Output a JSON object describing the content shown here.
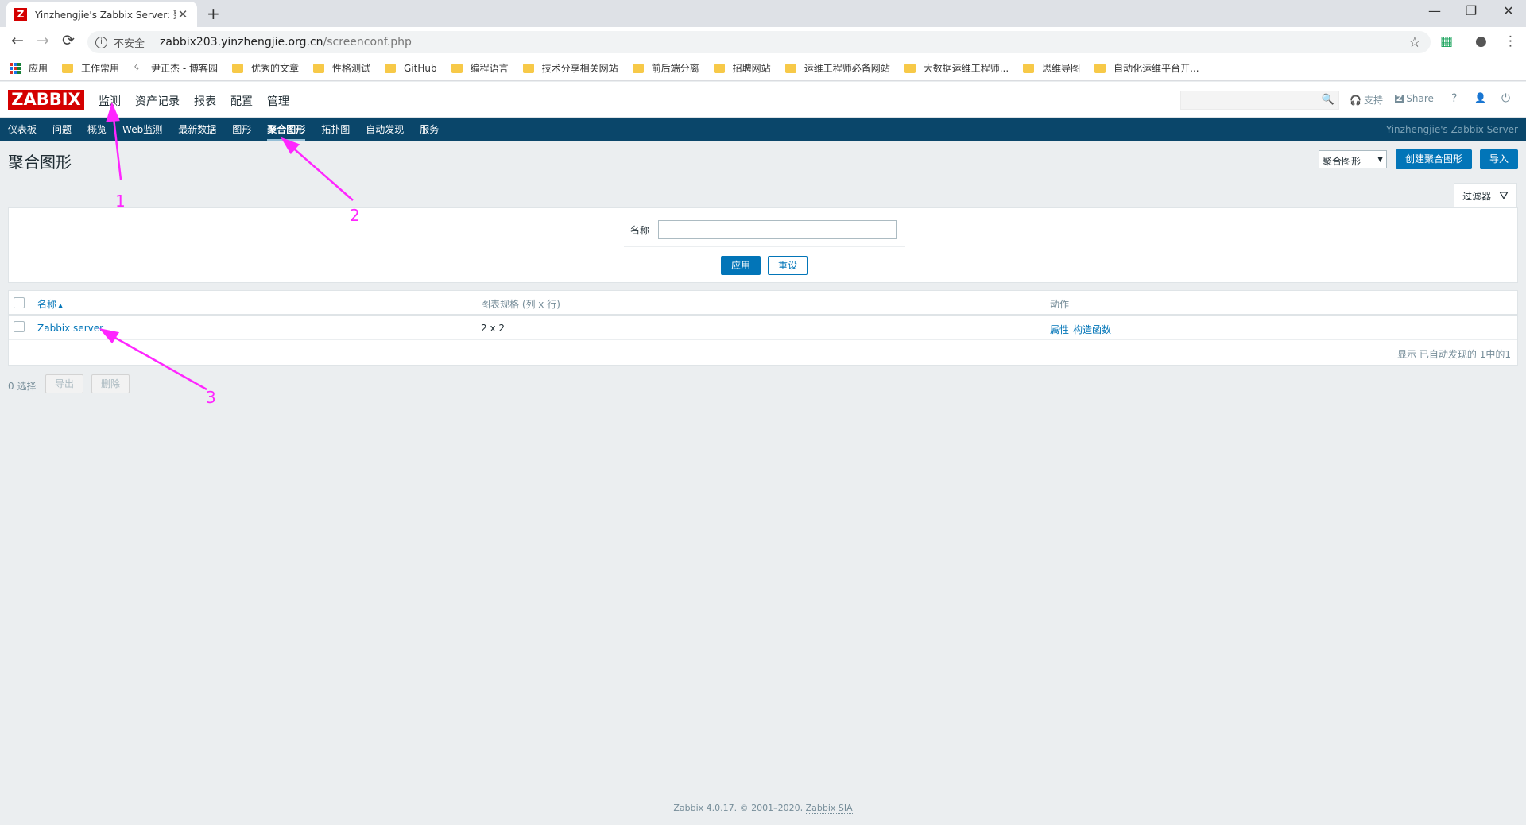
{
  "browser": {
    "tab_title": "Yinzhengjie's Zabbix Server: 聚合图形",
    "tab_favicon": "Z",
    "close_glyph": "✕",
    "newtab_glyph": "+",
    "window_controls": {
      "minimize": "—",
      "restore": "❐",
      "close": "✕"
    },
    "nav": {
      "back": "←",
      "forward": "→",
      "reload": "⟳"
    },
    "insecure_label": "不安全",
    "info_glyph": "i",
    "url_host": "zabbix203.yinzhengjie.org.cn",
    "url_path": "/screenconf.php",
    "star_glyph": "☆",
    "extension_glyph": "▦",
    "profile_glyph": "●",
    "menu_glyph": "⋮",
    "bookmarks": [
      {
        "label": "应用",
        "icon": "apps-grid-icon"
      },
      {
        "label": "工作常用",
        "icon": "folder-icon"
      },
      {
        "label": "尹正杰 - 博客园",
        "icon": "site-icon"
      },
      {
        "label": "优秀的文章",
        "icon": "folder-icon"
      },
      {
        "label": "性格测试",
        "icon": "folder-icon"
      },
      {
        "label": "GitHub",
        "icon": "folder-icon"
      },
      {
        "label": "编程语言",
        "icon": "folder-icon"
      },
      {
        "label": "技术分享相关网站",
        "icon": "folder-icon"
      },
      {
        "label": "前后端分离",
        "icon": "folder-icon"
      },
      {
        "label": "招聘网站",
        "icon": "folder-icon"
      },
      {
        "label": "运维工程师必备网站",
        "icon": "folder-icon"
      },
      {
        "label": "大数据运维工程师...",
        "icon": "folder-icon"
      },
      {
        "label": "思维导图",
        "icon": "folder-icon"
      },
      {
        "label": "自动化运维平台开...",
        "icon": "folder-icon"
      }
    ]
  },
  "zabbix": {
    "logo": "ZABBIX",
    "top_menu": [
      "监测",
      "资产记录",
      "报表",
      "配置",
      "管理"
    ],
    "header_links": {
      "support": "支持",
      "share": "Share",
      "help": "?",
      "user": "👤",
      "logout": "⏻"
    },
    "search_glyph": "🔍",
    "sub_menu": [
      "仪表板",
      "问题",
      "概览",
      "Web监测",
      "最新数据",
      "图形",
      "聚合图形",
      "拓扑图",
      "自动发现",
      "服务"
    ],
    "active_sub": "聚合图形",
    "server_name": "Yinzhengjie's Zabbix Server",
    "page_title": "聚合图形",
    "view_select": {
      "value": "聚合图形",
      "arrow": "▼"
    },
    "create_button": "创建聚合图形",
    "import_button": "导入",
    "filter": {
      "tab_label": "过滤器",
      "funnel_glyph": "⛛",
      "name_label": "名称",
      "name_value": "",
      "apply": "应用",
      "reset": "重设"
    },
    "table": {
      "headers": {
        "name": "名称",
        "sort": "▲",
        "dimension": "图表规格 (列 x 行)",
        "actions": "动作"
      },
      "rows": [
        {
          "name": "Zabbix server",
          "dimension": "2 x 2",
          "action_props": "属性",
          "action_constructor": "构造函数"
        }
      ],
      "footer": "显示 已自动发现的 1中的1"
    },
    "selected": "0 选择",
    "export_button": "导出",
    "delete_button": "删除",
    "footer": {
      "text": "Zabbix 4.0.17. © 2001–2020, ",
      "company": "Zabbix SIA"
    }
  },
  "annotations": {
    "color": "#ff26ff",
    "labels": [
      "1",
      "2",
      "3"
    ]
  }
}
